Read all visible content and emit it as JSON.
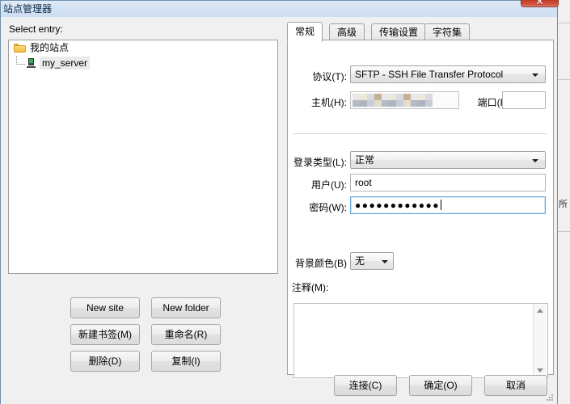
{
  "window": {
    "title": "站点管理器",
    "close_icon": "close-icon",
    "close_glyph": "✕"
  },
  "left_pane": {
    "select_entry_label": "Select entry:",
    "tree": {
      "root": {
        "label": "我的站点",
        "icon": "folder-icon"
      },
      "child": {
        "label": "my_server",
        "icon": "server-icon",
        "selected": true
      }
    },
    "buttons": [
      {
        "label": "New site"
      },
      {
        "label": "New folder"
      },
      {
        "label": "新建书签(M)"
      },
      {
        "label": "重命名(R)"
      },
      {
        "label": "删除(D)"
      },
      {
        "label": "复制(I)"
      }
    ]
  },
  "right_pane": {
    "tabs": [
      {
        "label": "常规",
        "active": true
      },
      {
        "label": "高级",
        "active": false
      },
      {
        "label": "传输设置",
        "active": false
      },
      {
        "label": "字符集",
        "active": false
      }
    ],
    "general": {
      "protocol_label": "协议(T):",
      "protocol_value": "SFTP - SSH File Transfer Protocol",
      "host_label": "主机(H):",
      "host_value": "",
      "host_redacted": true,
      "port_label": "端口(P):",
      "port_value": "",
      "port_placeholder": "",
      "logon_type_label": "登录类型(L):",
      "logon_type_value": "正常",
      "user_label": "用户(U):",
      "user_value": "root",
      "password_label": "密码(W):",
      "password_value": "●●●●●●●●●●●●",
      "password_focused": true,
      "background_color_label": "背景颜色(B)",
      "background_color_value": "无",
      "comments_label": "注释(M):",
      "comments_value": ""
    }
  },
  "footer": {
    "buttons": [
      {
        "label": "连接(C)"
      },
      {
        "label": "确定(O)"
      },
      {
        "label": "取消"
      }
    ]
  },
  "colors": {
    "titlebar_start": "#dfeaf6",
    "titlebar_end": "#cfdff1",
    "dialog_bg": "#f0f0f0",
    "close_red": "#c33a24",
    "focus_border": "#6aa8d8",
    "selection_bg": "#ebebeb"
  }
}
